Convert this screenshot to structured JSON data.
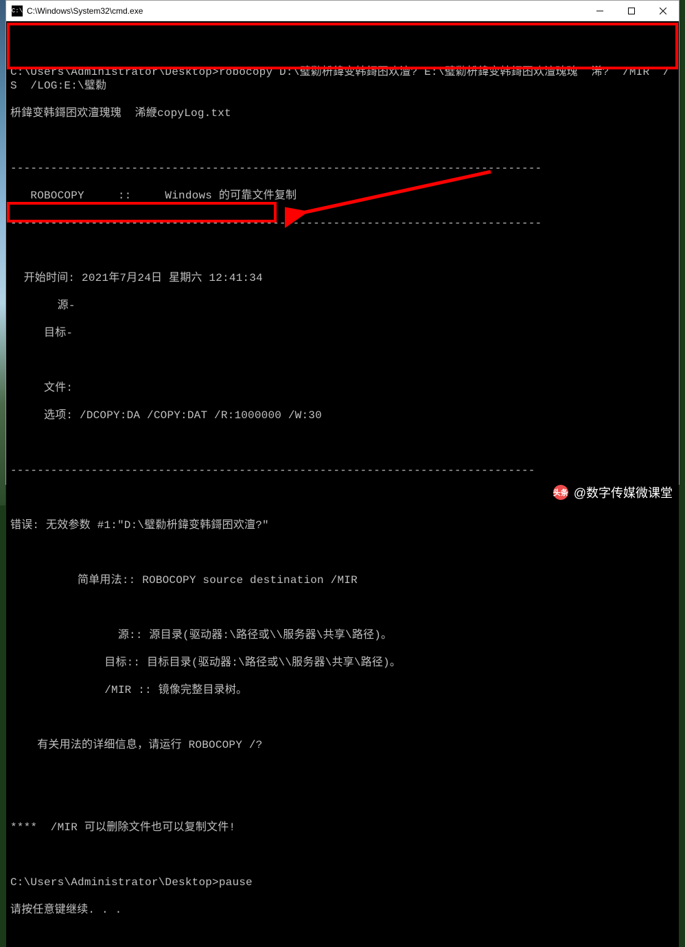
{
  "window": {
    "title": "C:\\Windows\\System32\\cmd.exe",
    "icon_label": "cmd"
  },
  "console": {
    "blank0": "",
    "cmd_line1": "C:\\Users\\Administrator\\Desktop>robocopy D:\\璧勬枡鍏变韩鎶囨欢澶? E:\\璧勬枡鍏变韩鎶囨欢澶瑰瑰  浠?  /MIR  /S  /LOG:E:\\璧勬",
    "cmd_line2": "枡鍏变韩鎶囨欢澶瑰瑰  浠緶copyLog.txt",
    "blank1": "",
    "sep1": "-------------------------------------------------------------------------------",
    "robocopy_header": "   ROBOCOPY     ::     Windows 的可靠文件复制",
    "sep2": "-------------------------------------------------------------------------------",
    "blank2": "",
    "start_time": "  开始时间: 2021年7月24日 星期六 12:41:34",
    "source": "       源-",
    "target": "     目标-",
    "blank3": "",
    "files": "     文件:",
    "options": "     选项: /DCOPY:DA /COPY:DAT /R:1000000 /W:30",
    "blank4": "",
    "sep3": "------------------------------------------------------------------------------",
    "blank5": "",
    "error": "错误: 无效参数 #1:\"D:\\璧勬枡鍏变韩鎶囨欢澶?\"",
    "blank6": "",
    "usage_simple": "          简单用法:: ROBOCOPY source destination /MIR",
    "blank7": "",
    "usage_source": "                源:: 源目录(驱动器:\\路径或\\\\服务器\\共享\\路径)。",
    "usage_target": "              目标:: 目标目录(驱动器:\\路径或\\\\服务器\\共享\\路径)。",
    "usage_mir": "              /MIR :: 镜像完整目录树。",
    "blank8": "",
    "usage_detail": "    有关用法的详细信息，请运行 ROBOCOPY /?",
    "blank9": "",
    "blank10": "",
    "mir_note": "****  /MIR 可以删除文件也可以复制文件!",
    "blank11": "",
    "pause_cmd": "C:\\Users\\Administrator\\Desktop>pause",
    "pause_msg": "请按任意键继续. . ."
  },
  "watermark": {
    "logo": "头条",
    "text": "@数字传媒微课堂"
  }
}
